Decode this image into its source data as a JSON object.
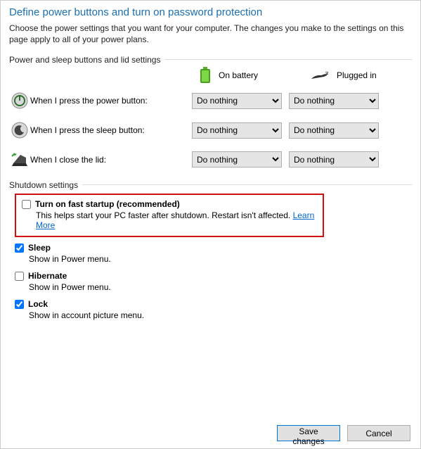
{
  "title": "Define power buttons and turn on password protection",
  "subtitle": "Choose the power settings that you want for your computer. The changes you make to the settings on this page apply to all of your power plans.",
  "section1": {
    "legend": "Power and sleep buttons and lid settings",
    "headers": {
      "battery": "On battery",
      "plugged": "Plugged in"
    },
    "rows": {
      "power": {
        "label": "When I press the power button:",
        "battery": "Do nothing",
        "plugged": "Do nothing"
      },
      "sleep": {
        "label": "When I press the sleep button:",
        "battery": "Do nothing",
        "plugged": "Do nothing"
      },
      "lid": {
        "label": "When I close the lid:",
        "battery": "Do nothing",
        "plugged": "Do nothing"
      }
    },
    "option": "Do nothing"
  },
  "section2": {
    "legend": "Shutdown settings",
    "fast_startup": {
      "label": "Turn on fast startup (recommended)",
      "desc": "This helps start your PC faster after shutdown. Restart isn't affected. ",
      "link": "Learn More",
      "checked": false
    },
    "sleep": {
      "label": "Sleep",
      "desc": "Show in Power menu.",
      "checked": true
    },
    "hibernate": {
      "label": "Hibernate",
      "desc": "Show in Power menu.",
      "checked": false
    },
    "lock": {
      "label": "Lock",
      "desc": "Show in account picture menu.",
      "checked": true
    }
  },
  "buttons": {
    "save": "Save changes",
    "cancel": "Cancel"
  }
}
